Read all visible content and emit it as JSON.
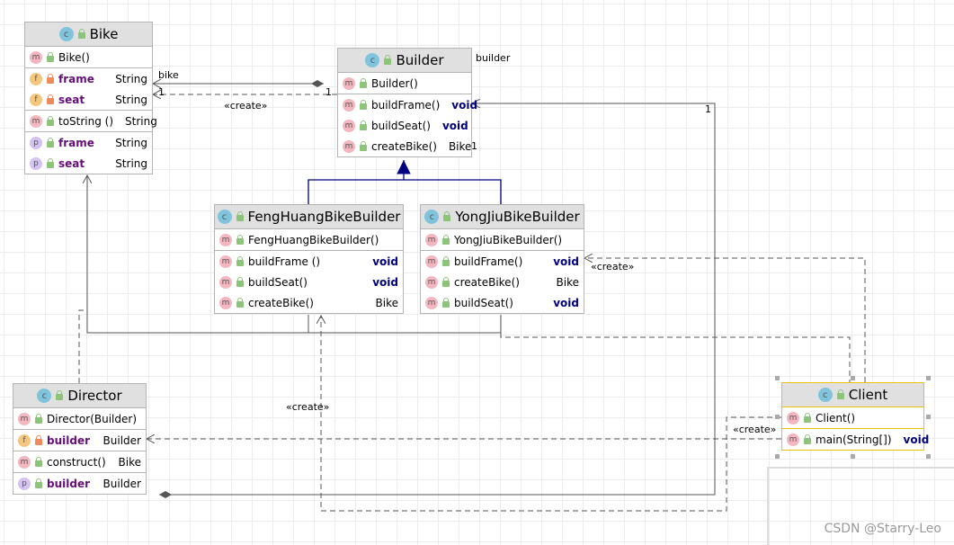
{
  "classes": [
    {
      "id": "bike",
      "title": "Bike",
      "sections": [
        [
          {
            "icon": "m",
            "vis": "public",
            "name": "Bike()",
            "type": ""
          }
        ],
        [
          {
            "icon": "f",
            "vis": "private",
            "name": "frame",
            "type": "String",
            "field": true
          },
          {
            "icon": "f",
            "vis": "private",
            "name": "seat",
            "type": "String",
            "field": true
          }
        ],
        [
          {
            "icon": "m",
            "vis": "public",
            "name": "toString ()",
            "type": "String"
          }
        ],
        [
          {
            "icon": "p",
            "vis": "public",
            "name": "frame",
            "type": "String",
            "field": true
          },
          {
            "icon": "p",
            "vis": "public",
            "name": "seat",
            "type": "String",
            "field": true
          }
        ]
      ]
    },
    {
      "id": "builder",
      "title": "Builder",
      "sections": [
        [
          {
            "icon": "m",
            "vis": "public",
            "name": "Builder()",
            "type": ""
          }
        ],
        [
          {
            "icon": "m",
            "vis": "public",
            "name": "buildFrame()",
            "type": "void",
            "kw": true
          },
          {
            "icon": "m",
            "vis": "public",
            "name": "buildSeat()",
            "type": "void",
            "kw": true
          },
          {
            "icon": "m",
            "vis": "public",
            "name": "createBike()",
            "type": "Bike"
          }
        ]
      ]
    },
    {
      "id": "fenghuang",
      "title": "FengHuangBikeBuilder",
      "sections": [
        [
          {
            "icon": "m",
            "vis": "public",
            "name": "FengHuangBikeBuilder()",
            "type": ""
          }
        ],
        [
          {
            "icon": "m",
            "vis": "public",
            "name": "buildFrame ()",
            "type": "void",
            "kw": true
          },
          {
            "icon": "m",
            "vis": "public",
            "name": "buildSeat()",
            "type": "void",
            "kw": true
          },
          {
            "icon": "m",
            "vis": "public",
            "name": "createBike()",
            "type": "Bike"
          }
        ]
      ]
    },
    {
      "id": "yongjiu",
      "title": "YongJiuBikeBuilder",
      "sections": [
        [
          {
            "icon": "m",
            "vis": "public",
            "name": "YongJiuBikeBuilder()",
            "type": ""
          }
        ],
        [
          {
            "icon": "m",
            "vis": "public",
            "name": "buildFrame()",
            "type": "void",
            "kw": true
          },
          {
            "icon": "m",
            "vis": "public",
            "name": "createBike()",
            "type": "Bike"
          },
          {
            "icon": "m",
            "vis": "public",
            "name": "buildSeat()",
            "type": "void",
            "kw": true
          }
        ]
      ]
    },
    {
      "id": "director",
      "title": "Director",
      "sections": [
        [
          {
            "icon": "m",
            "vis": "public",
            "name": "Director(Builder)",
            "type": ""
          }
        ],
        [
          {
            "icon": "f",
            "vis": "private",
            "name": "builder",
            "type": "Builder",
            "field": true
          }
        ],
        [
          {
            "icon": "m",
            "vis": "public",
            "name": "construct()",
            "type": "Bike"
          }
        ],
        [
          {
            "icon": "p",
            "vis": "public",
            "name": "builder",
            "type": "Builder",
            "field": true
          }
        ]
      ]
    },
    {
      "id": "client",
      "title": "Client",
      "selected": true,
      "sections": [
        [
          {
            "icon": "m",
            "vis": "public",
            "name": "Client()",
            "type": ""
          }
        ],
        [
          {
            "icon": "m",
            "vis": "public",
            "name": "main(String[])",
            "type": "void",
            "kw": true
          }
        ]
      ]
    }
  ],
  "labels": {
    "bike_role": "bike",
    "mult_bike": "1",
    "mult_builder_side": "1",
    "builder_role": "builder",
    "mult_createbike": "1",
    "mult_director_builder": "1",
    "create1": "«create»",
    "create2": "«create»",
    "create3": "«create»",
    "create4": "«create»"
  },
  "watermark": "CSDN @Starry-Leo",
  "colors": {
    "field": "#660e7a",
    "keyword": "#000080",
    "inheritance": "#000080",
    "selection": "#f0c000",
    "header": "#e0e0e0"
  }
}
